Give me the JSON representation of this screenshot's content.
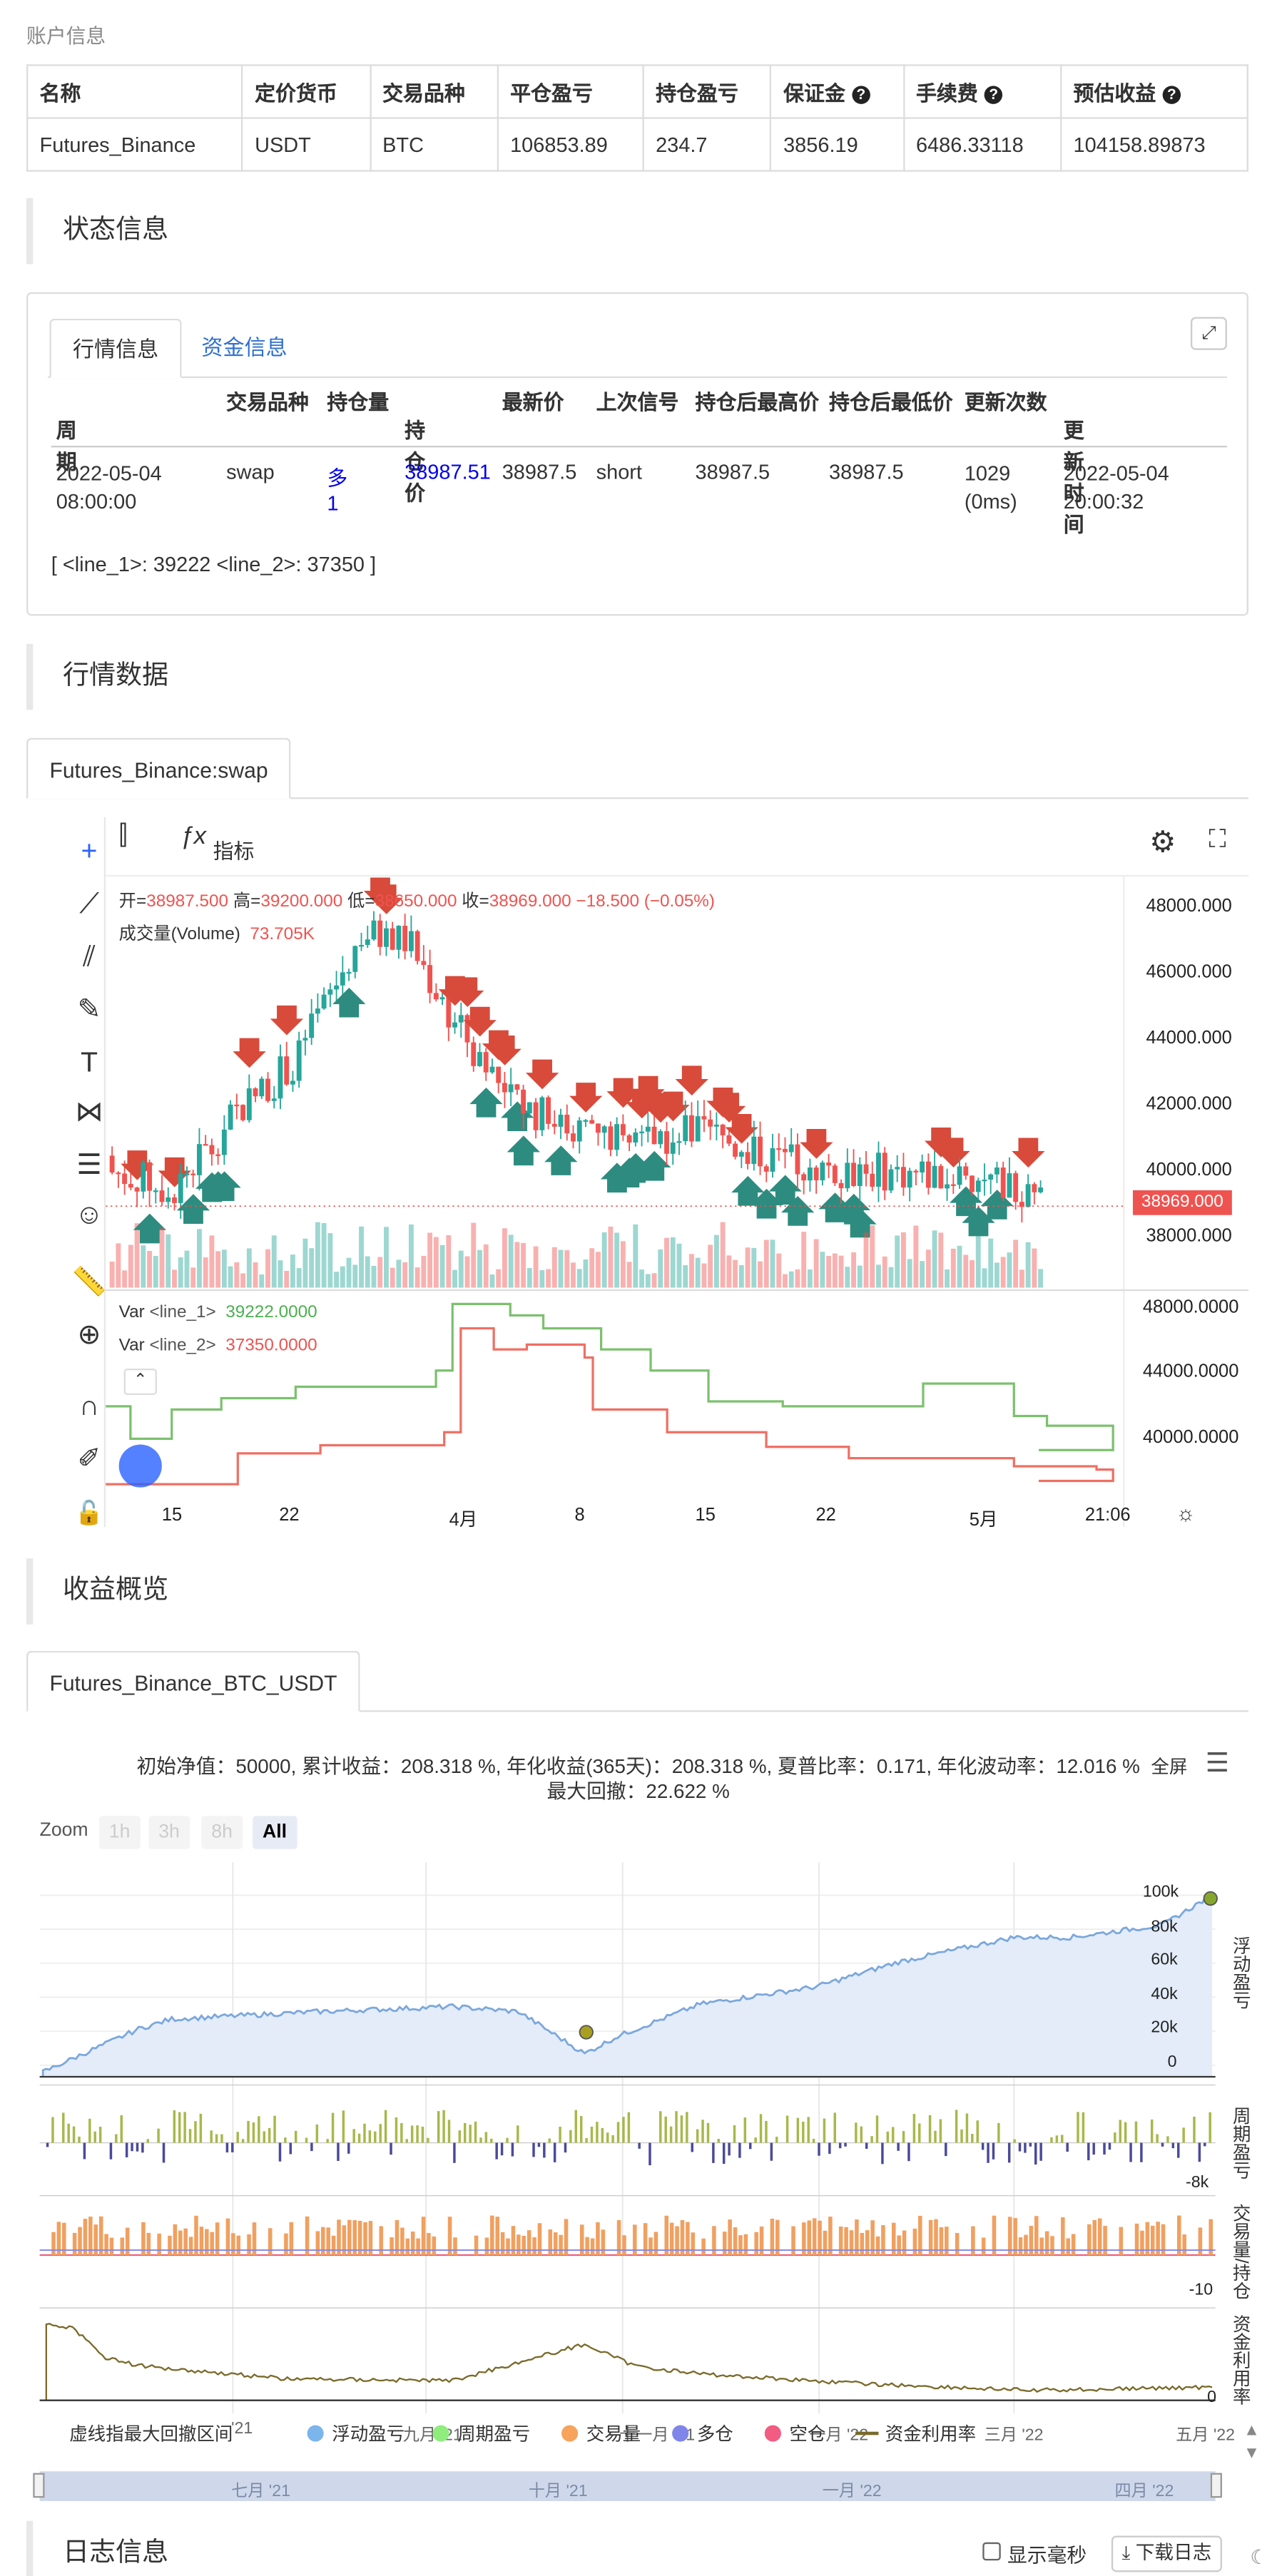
{
  "account": {
    "title": "账户信息",
    "headers": [
      "名称",
      "定价货币",
      "交易品种",
      "平仓盈亏",
      "持仓盈亏",
      "保证金",
      "手续费",
      "预估收益"
    ],
    "values": [
      "Futures_Binance",
      "USDT",
      "BTC",
      "106853.89",
      "234.7",
      "3856.19",
      "6486.33118",
      "104158.89873"
    ]
  },
  "status": {
    "title": "状态信息",
    "tabs": [
      "行情信息",
      "资金信息"
    ],
    "headers": [
      "周期",
      "交易品种",
      "持仓量",
      "持仓价",
      "最新价",
      "上次信号",
      "持仓后最高价",
      "持仓后最低价",
      "更新次数",
      "更新时间"
    ],
    "row": {
      "period": "2022-05-04 08:00:00",
      "symbol": "swap",
      "position": "多 1",
      "price": "38987.51",
      "last": "38987.5",
      "signal": "short",
      "high": "38987.5",
      "low": "38987.5",
      "updates": "1029 (0ms)",
      "time": "2022-05-04 20:00:32"
    },
    "lines": "[ <line_1>: 39222 <line_2>: 37350 ]"
  },
  "market": {
    "title": "行情数据",
    "tab": "Futures_Binance:swap",
    "indicator_label": "指标",
    "ohlc": {
      "o_l": "开=",
      "o": "38987.500",
      "h_l": "高=",
      "h": "39200.000",
      "l_l": "低=",
      "l": "38650.000",
      "c_l": "收=",
      "c": "38969.000",
      "chg": "−18.500 (−0.05%)"
    },
    "volume_label": "成交量(Volume)",
    "volume_value": "73.705K",
    "price_axis": [
      "48000.000",
      "46000.000",
      "44000.000",
      "42000.000",
      "40000.000",
      "38000.000"
    ],
    "last_price": "38969.000",
    "var1_name": "Var",
    "var1_label": "<line_1>",
    "var1_value": "39222.0000",
    "var2_name": "Var",
    "var2_label": "<line_2>",
    "var2_value": "37350.0000",
    "var_axis": [
      "48000.0000",
      "44000.0000",
      "40000.0000"
    ],
    "time_axis": [
      "15",
      "22",
      "4月",
      "8",
      "15",
      "22",
      "5月",
      "21:06"
    ]
  },
  "profit": {
    "title": "收益概览",
    "tab": "Futures_Binance_BTC_USDT",
    "summary1": "初始净值：50000, 累计收益：208.318 %, 年化收益(365天)：208.318 %, 夏普比率：0.171, 年化波动率：12.016 %",
    "summary2": "最大回撤：22.622 %",
    "fullscreen": "全屏",
    "zoom_label": "Zoom",
    "zoom": [
      "1h",
      "3h",
      "8h",
      "All"
    ],
    "axis_right_1": [
      "100k",
      "80k",
      "60k",
      "40k",
      "20k",
      "0"
    ],
    "axis_right_2": [
      "-8k"
    ],
    "axis_right_3": [
      "-10"
    ],
    "axis_right_4": [
      "0"
    ],
    "vlabels": [
      "浮动盈亏",
      "周期盈亏",
      "交易量/持仓",
      "资金利用率"
    ],
    "x_axis": [
      "'21",
      "九月 '21",
      "十一月 '21",
      "一月 '22",
      "三月 '22",
      "五月 '22"
    ],
    "nav_axis": [
      "七月 '21",
      "十月 '21",
      "一月 '22",
      "四月 '22"
    ],
    "legend": [
      "虚线指最大回撤区间",
      "浮动盈亏",
      "周期盈亏",
      "交易量",
      "多仓",
      "空仓",
      "资金利用率"
    ],
    "colors": {
      "float": "#7cb5ec",
      "period": "#90ed7d",
      "volume": "#f7a35c",
      "long": "#8085e9",
      "short": "#f15c80",
      "util": "#7a6a2a"
    }
  },
  "log": {
    "title": "日志信息",
    "ms_label": "显示毫秒",
    "download": "下载日志"
  }
}
